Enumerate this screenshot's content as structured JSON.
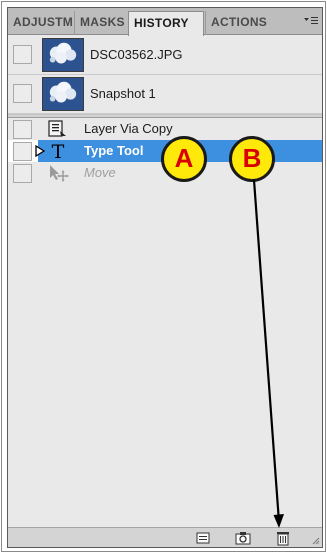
{
  "tabs": [
    {
      "label": "ADJUSTM",
      "active": false
    },
    {
      "label": "MASKS",
      "active": false
    },
    {
      "label": "HISTORY",
      "active": true
    },
    {
      "label": "ACTIONS",
      "active": false
    }
  ],
  "snapshots": [
    {
      "label": "DSC03562.JPG"
    },
    {
      "label": "Snapshot 1"
    }
  ],
  "steps": [
    {
      "label": "Layer Via Copy",
      "icon": "layer-via-copy-icon",
      "state": "normal"
    },
    {
      "label": "Type Tool",
      "icon": "type-tool-icon",
      "state": "selected"
    },
    {
      "label": "Move",
      "icon": "move-tool-icon",
      "state": "greyed"
    }
  ],
  "annotations": {
    "a": "A",
    "b": "B"
  },
  "colors": {
    "selection": "#3d8fdf",
    "annotation_fill": "#ffe90a",
    "annotation_text": "#d90000"
  },
  "toolbar": [
    "new-document-icon",
    "camera-icon",
    "trash-icon"
  ]
}
